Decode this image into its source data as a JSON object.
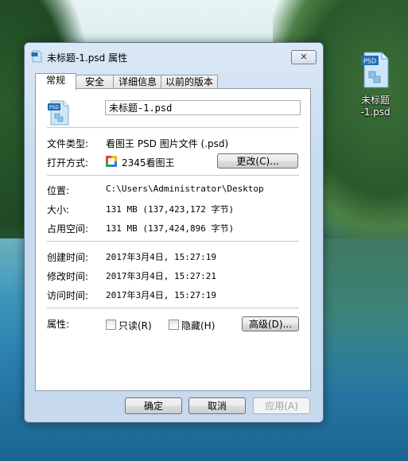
{
  "desktop": {
    "icon_label_line1": "未标题",
    "icon_label_line2": "-1.psd",
    "icon_badge": "PSD"
  },
  "window": {
    "title": "未标题-1.psd 属性",
    "close_label": "✕",
    "tabs": [
      {
        "label": "常规",
        "active": true
      },
      {
        "label": "安全",
        "active": false
      },
      {
        "label": "详细信息",
        "active": false
      },
      {
        "label": "以前的版本",
        "active": false
      }
    ],
    "file_badge": "PSD",
    "file_name": "未标题-1.psd",
    "file_type_label": "文件类型:",
    "file_type_value": "看图王 PSD 图片文件 (.psd)",
    "open_with_label": "打开方式:",
    "open_with_value": "2345看图王",
    "change_button": "更改(C)...",
    "location_label": "位置:",
    "location_value": "C:\\Users\\Administrator\\Desktop",
    "size_label": "大小:",
    "size_value": "131 MB (137,423,172 字节)",
    "disk_size_label": "占用空间:",
    "disk_size_value": "131 MB (137,424,896 字节)",
    "created_label": "创建时间:",
    "created_value": "2017年3月4日, 15:27:19",
    "modified_label": "修改时间:",
    "modified_value": "2017年3月4日, 15:27:21",
    "accessed_label": "访问时间:",
    "accessed_value": "2017年3月4日, 15:27:19",
    "attributes_label": "属性:",
    "readonly_label": "只读(R)",
    "hidden_label": "隐藏(H)",
    "advanced_button": "高级(D)...",
    "ok_button": "确定",
    "cancel_button": "取消",
    "apply_button": "应用(A)"
  }
}
